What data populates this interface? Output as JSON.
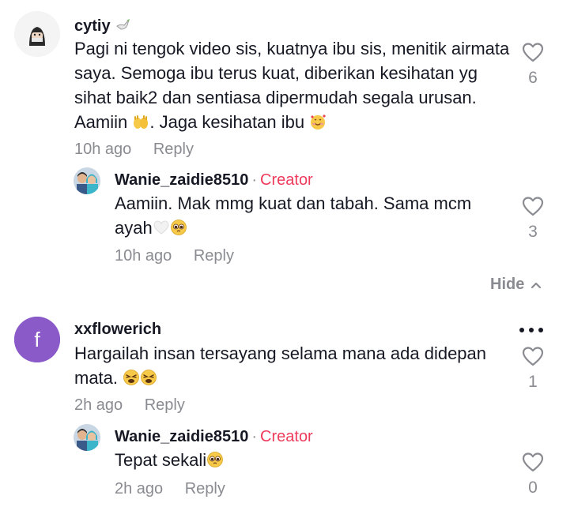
{
  "comments": [
    {
      "username": "cytiy",
      "text": "Pagi ni tengok video sis, kuatnya ibu sis, menitik airmata saya. Semoga ibu terus kuat, diberikan kesihatan yg sihat baik2 dan sentiasa dipermudah segala urusan. Aamiin",
      "text_tail": ". Jaga kesihatan ibu",
      "time": "10h ago",
      "reply_label": "Reply",
      "likes": "6",
      "reply": {
        "username": "Wanie_zaidie8510",
        "separator": "·",
        "badge": "Creator",
        "text": "Aamiin. Mak mmg kuat dan tabah. Sama mcm ayah",
        "time": "10h ago",
        "reply_label": "Reply",
        "likes": "3"
      }
    },
    {
      "username": "xxflowerich",
      "avatar_letter": "f",
      "text": "Hargailah insan tersayang selama mana ada didepan mata.",
      "time": "2h ago",
      "reply_label": "Reply",
      "likes": "1",
      "reply": {
        "username": "Wanie_zaidie8510",
        "separator": "·",
        "badge": "Creator",
        "text": "Tepat sekali",
        "time": "2h ago",
        "reply_label": "Reply",
        "likes": "0"
      }
    }
  ],
  "hide_label": "Hide",
  "icons": {
    "like": "heart-outline-icon",
    "more": "more-dots-icon",
    "hide": "chevron-up-icon"
  },
  "colors": {
    "creator": "#ee3a5b",
    "muted": "#8a8b91",
    "avatar_purple": "#8a5ac9"
  }
}
